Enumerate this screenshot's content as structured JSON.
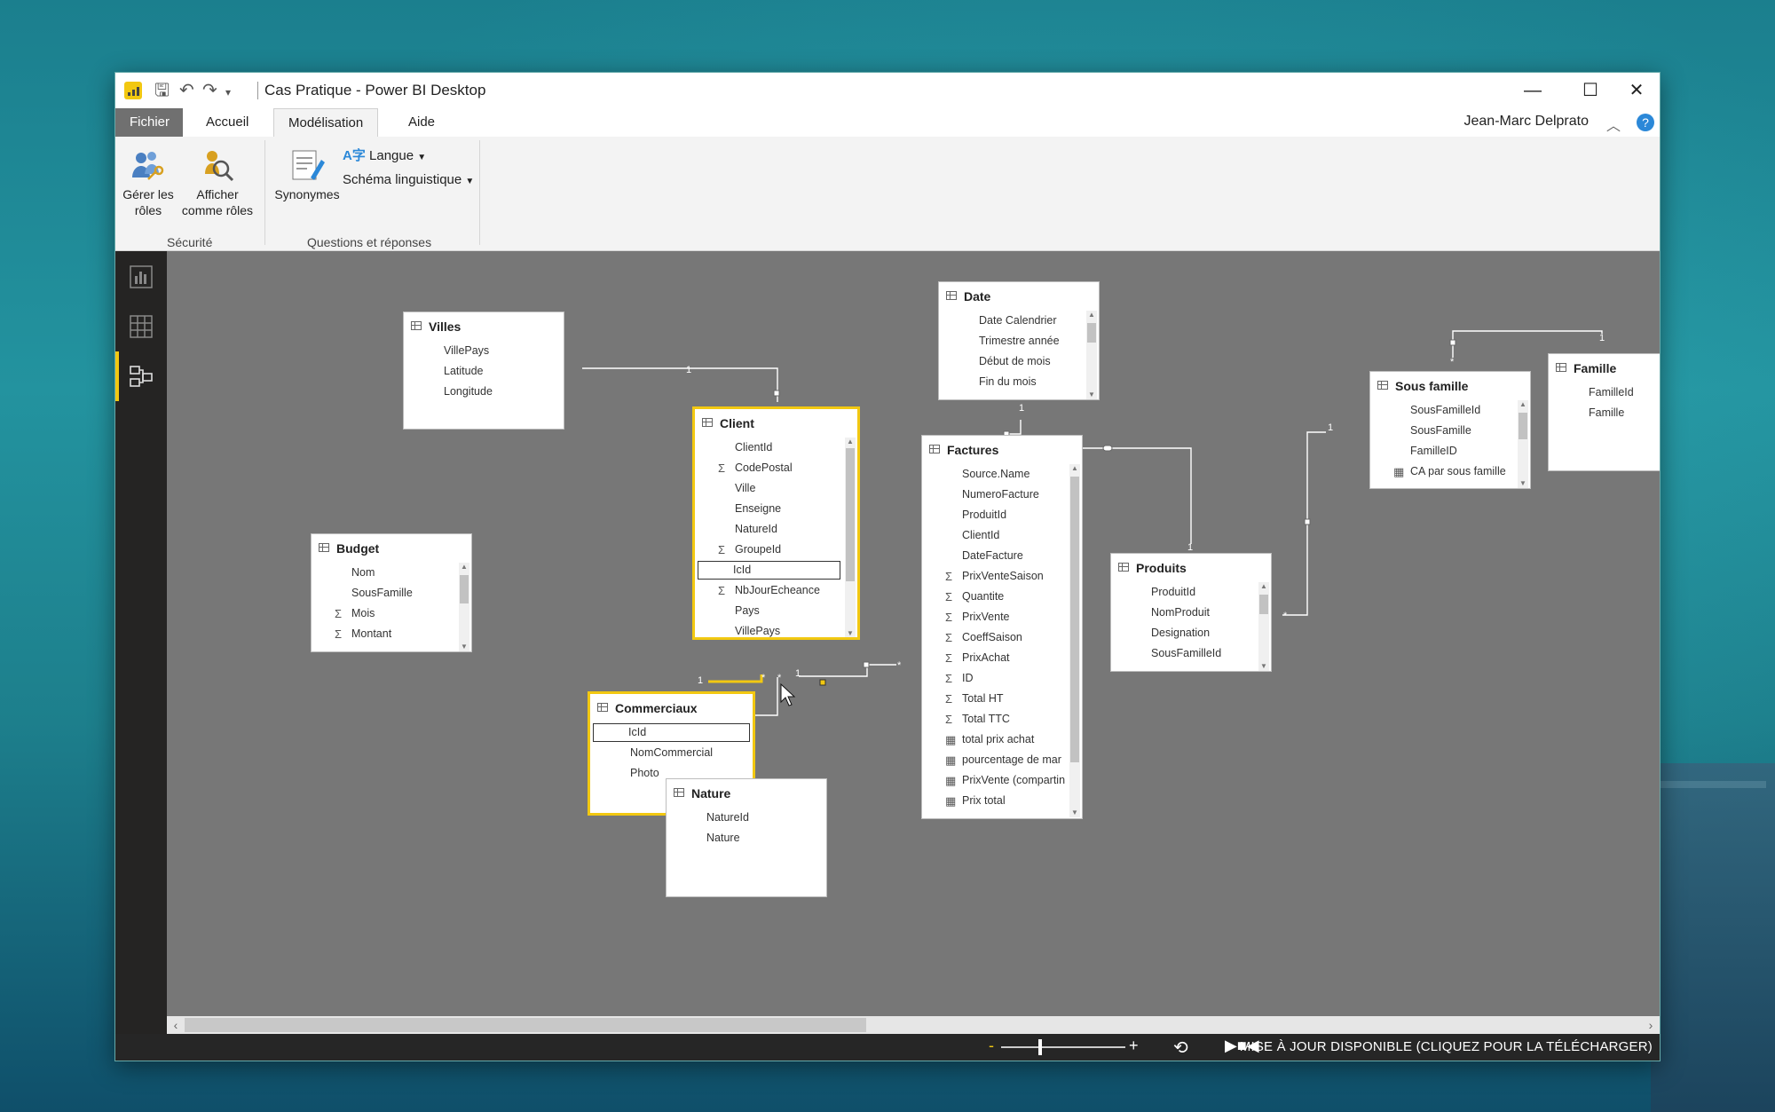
{
  "window": {
    "title": "Cas Pratique - Power BI Desktop",
    "status": "MISE À JOUR DISPONIBLE (CLIQUEZ POUR LA TÉLÉCHARGER)"
  },
  "tabs": [
    {
      "label": "Fichier"
    },
    {
      "label": "Accueil"
    },
    {
      "label": "Modélisation"
    },
    {
      "label": "Aide"
    }
  ],
  "user": "Jean-Marc Delprato",
  "ribbon": {
    "manage_roles": "Gérer les rôles",
    "view_as_roles": "Afficher comme rôles",
    "synonyms": "Synonymes",
    "language": "Langue",
    "schema": "Schéma linguistique",
    "group_security": "Sécurité",
    "group_qa": "Questions et réponses"
  },
  "colors": {
    "accent": "#f2c811",
    "canvas": "#777777",
    "help": "#2b88d8"
  },
  "tables": {
    "villes": {
      "name": "Villes",
      "fields": [
        "VillePays",
        "Latitude",
        "Longitude"
      ]
    },
    "date": {
      "name": "Date",
      "fields": [
        "Date Calendrier",
        "Trimestre année",
        "Début de mois",
        "Fin du mois"
      ]
    },
    "client": {
      "name": "Client",
      "fields": [
        "ClientId",
        "CodePostal",
        "Ville",
        "Enseigne",
        "NatureId",
        "GroupeId",
        "IcId",
        "NbJourEcheance",
        "Pays",
        "VillePays"
      ]
    },
    "factures": {
      "name": "Factures",
      "fields": [
        "Source.Name",
        "NumeroFacture",
        "ProduitId",
        "ClientId",
        "DateFacture",
        "PrixVenteSaison",
        "Quantite",
        "PrixVente",
        "CoeffSaison",
        "PrixAchat",
        "ID",
        "Total HT",
        "Total TTC",
        "total prix achat",
        "pourcentage de mar",
        "PrixVente (compartin",
        "Prix total"
      ]
    },
    "budget": {
      "name": "Budget",
      "fields": [
        "Nom",
        "SousFamille",
        "Mois",
        "Montant"
      ]
    },
    "commerciaux": {
      "name": "Commerciaux",
      "fields": [
        "IcId",
        "NomCommercial",
        "Photo"
      ]
    },
    "nature": {
      "name": "Nature",
      "fields": [
        "NatureId",
        "Nature"
      ]
    },
    "produits": {
      "name": "Produits",
      "fields": [
        "ProduitId",
        "NomProduit",
        "Designation",
        "SousFamilleId"
      ]
    },
    "sousfamille": {
      "name": "Sous famille",
      "fields": [
        "SousFamilleId",
        "SousFamille",
        "FamilleID",
        "CA par sous famille"
      ]
    },
    "famille": {
      "name": "Famille",
      "fields": [
        "FamilleId",
        "Famille"
      ]
    }
  },
  "relations": {
    "one": "1",
    "many": "*"
  }
}
